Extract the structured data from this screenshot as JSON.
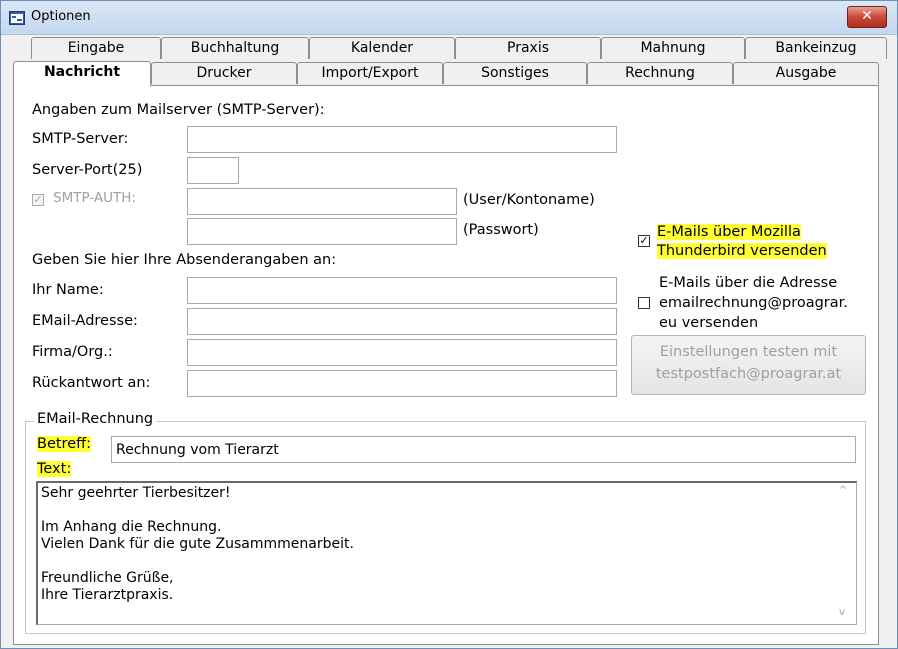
{
  "window": {
    "title": "Optionen",
    "close_glyph": "✕"
  },
  "tabs_row1": [
    "Eingabe",
    "Buchhaltung",
    "Kalender",
    "Praxis",
    "Mahnung",
    "Bankeinzug"
  ],
  "tabs_row2": [
    "Nachricht",
    "Drucker",
    "Import/Export",
    "Sonstiges",
    "Rechnung",
    "Ausgabe"
  ],
  "active_tab": "Nachricht",
  "smtp": {
    "heading": "Angaben zum Mailserver (SMTP-Server):",
    "server_label": "SMTP-Server:",
    "server_value": "",
    "port_label": "Server-Port(25)",
    "port_value": "",
    "auth_label": "SMTP-AUTH:",
    "auth_checked_glyph": "✓",
    "user_value": "",
    "user_hint": "(User/Kontoname)",
    "password_value": "",
    "password_hint": "(Passwort)"
  },
  "sender": {
    "heading": "Geben Sie hier Ihre Absenderangaben an:",
    "name_label": "Ihr Name:",
    "name_value": "",
    "email_label": "EMail-Adresse:",
    "email_value": "",
    "company_label": "Firma/Org.:",
    "company_value": "",
    "reply_label": "Rückantwort an:",
    "reply_value": ""
  },
  "options": {
    "thunderbird_line1": "E-Mails über Mozilla",
    "thunderbird_line2": "Thunderbird versenden",
    "thunderbird_glyph": "✓",
    "address_line1": "E-Mails über die Adresse",
    "address_line2": "emailrechnung@proagrar.",
    "address_line3": "eu versenden",
    "test_line1": "Einstellungen testen mit",
    "test_line2": "testpostfach@proagrar.at"
  },
  "invoice": {
    "group_title": "EMail-Rechnung",
    "subject_label": "Betreff:",
    "subject_value": "Rechnung vom Tierarzt",
    "text_label": "Text:",
    "text_value": "Sehr geehrter Tierbesitzer!\n\nIm Anhang die Rechnung.\nVielen Dank für die gute Zusammmenarbeit.\n\nFreundliche Grüße,\nIhre Tierarztpraxis.",
    "scroll_up": "^",
    "scroll_down": "v"
  },
  "colors": {
    "highlight": "#ffff33",
    "close_button": "#c9493a",
    "titlebar": "#c4d7ef"
  }
}
